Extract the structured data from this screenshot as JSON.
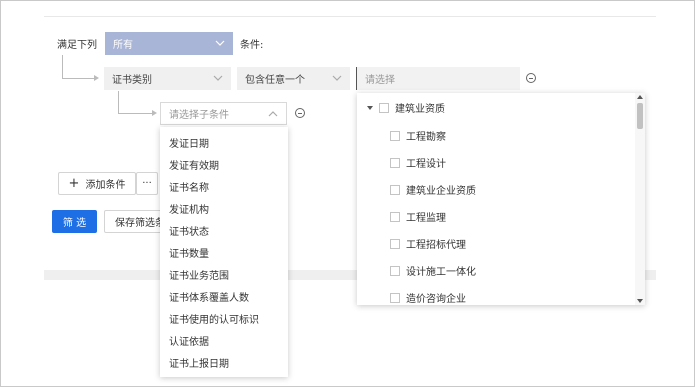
{
  "filter": {
    "match_label": "满足下列",
    "match_value": "所有",
    "condition_label": "条件:",
    "field_value": "证书类别",
    "operator_value": "包含任意一个",
    "value_placeholder": "请选择",
    "sub_placeholder": "请选择子条件"
  },
  "buttons": {
    "add_condition": "添加条件",
    "more": "···",
    "filter": "筛 选",
    "save_filter": "保存筛选条"
  },
  "sub_options": [
    "发证日期",
    "发证有效期",
    "证书名称",
    "发证机构",
    "证书状态",
    "证书数量",
    "证书业务范围",
    "证书体系覆盖人数",
    "证书使用的认可标识",
    "认证依据",
    "证书上报日期"
  ],
  "tree": {
    "root": "建筑业资质",
    "children": [
      "工程勘察",
      "工程设计",
      "建筑业企业资质",
      "工程监理",
      "工程招标代理",
      "设计施工一体化",
      "造价咨询企业"
    ]
  },
  "icons": {
    "chevron": "chevron-down-icon",
    "chevron_up": "chevron-up-icon",
    "minus_circle": "minus-circle-icon",
    "plus": "plus-icon",
    "caret": "caret-down-icon",
    "scroll_up": "scroll-up-arrow-icon",
    "scroll_down": "scroll-down-arrow-icon"
  },
  "colors": {
    "primary": "#1e6fe6",
    "select_active": "#a9b5d6",
    "field_bg": "#f0f0f0"
  }
}
